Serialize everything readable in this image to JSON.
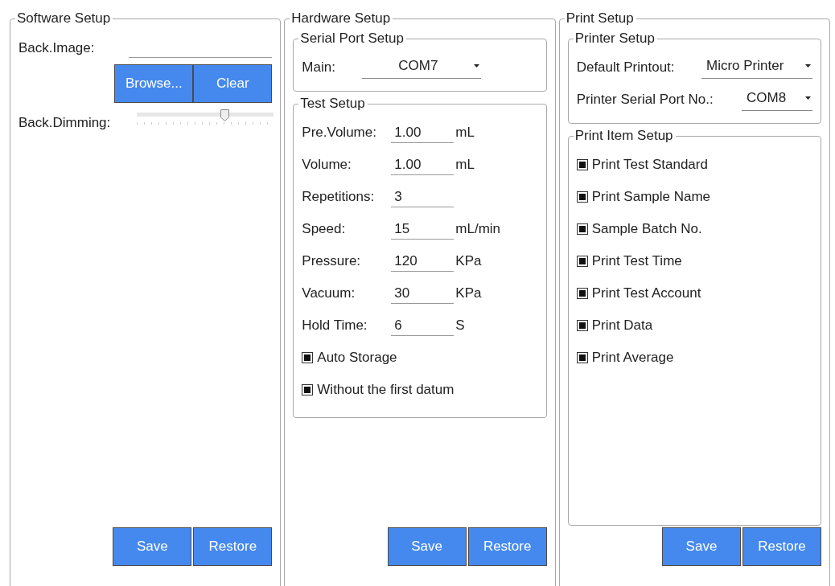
{
  "software": {
    "title": "Software Setup",
    "back_image": {
      "label": "Back.Image:"
    },
    "buttons": [
      "Browse...",
      "Clear"
    ],
    "dimming": {
      "label": "Back.Dimming:",
      "level": 0.64
    },
    "footer_buttons": [
      "Save",
      "Restore"
    ]
  },
  "hardware": {
    "title": "Hardware Setup",
    "serial_port": {
      "title": "Serial Port Setup",
      "label": "Main:",
      "value": "COM7"
    },
    "test_setup": {
      "title": "Test Setup",
      "fields": [
        {
          "label": "Pre.Volume:",
          "value": "1.00",
          "unit": "mL"
        },
        {
          "label": "Volume:",
          "value": "1.00",
          "unit": "mL"
        },
        {
          "label": "Repetitions:",
          "value": "3"
        },
        {
          "label": "Speed:",
          "value": "15",
          "unit": "mL/min"
        },
        {
          "label": "Pressure:",
          "value": "120",
          "unit": "KPa"
        },
        {
          "label": "Vacuum:",
          "value": "30",
          "unit": "KPa"
        },
        {
          "label": "Hold Time:",
          "value": "6",
          "unit": "S"
        }
      ],
      "options": [
        {
          "label": "Auto Storage",
          "checked": true
        },
        {
          "label": "Without the first datum",
          "checked": true
        }
      ]
    },
    "footer_buttons": [
      "Save",
      "Restore"
    ]
  },
  "print": {
    "title": "Print Setup",
    "printer_setup": {
      "title": "Printer Setup",
      "fields": [
        {
          "label": "Default Printout:",
          "value": "Micro Printer"
        },
        {
          "label": "Printer Serial Port No.:",
          "value": "COM8"
        }
      ]
    },
    "print_items": {
      "title": "Print Item Setup",
      "items": [
        {
          "label": "Print Test Standard",
          "checked": true
        },
        {
          "label": "Print Sample Name",
          "checked": true
        },
        {
          "label": "Sample Batch No.",
          "checked": true
        },
        {
          "label": "Print Test Time",
          "checked": true
        },
        {
          "label": "Print Test Account",
          "checked": true
        },
        {
          "label": "Print Data",
          "checked": true
        },
        {
          "label": "Print Average",
          "checked": true
        }
      ]
    },
    "footer_buttons": [
      "Save",
      "Restore"
    ]
  }
}
